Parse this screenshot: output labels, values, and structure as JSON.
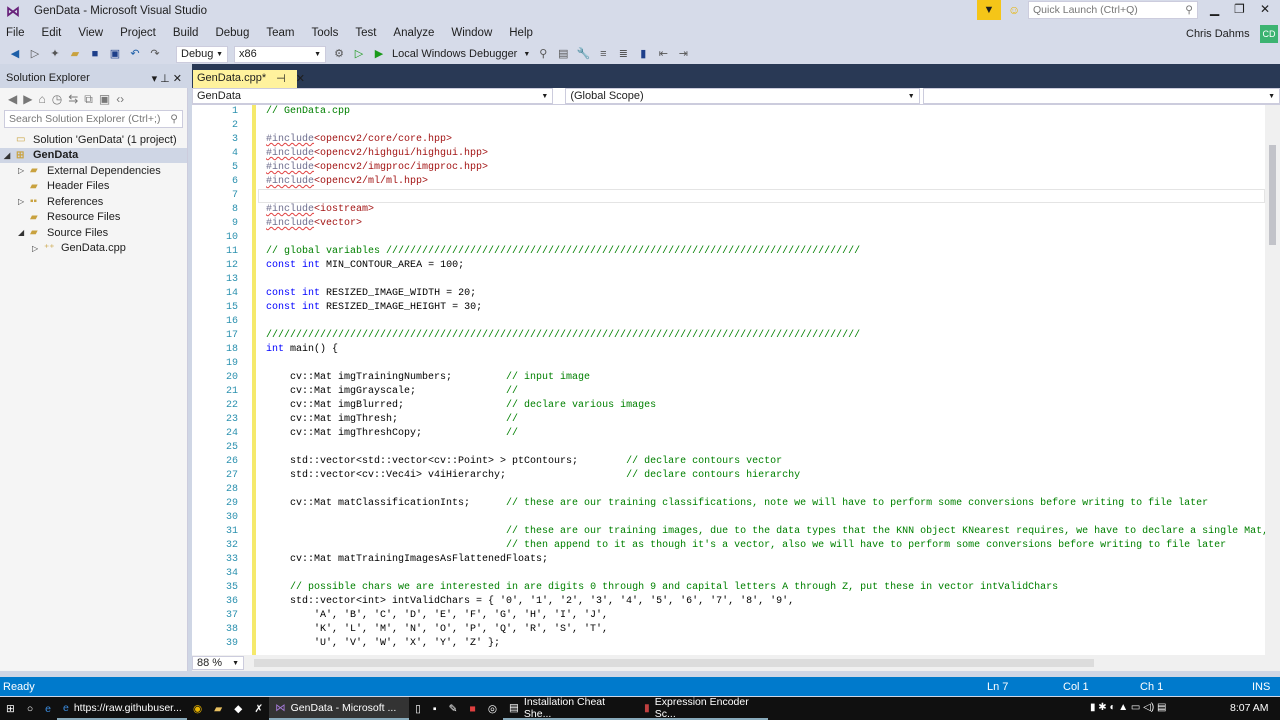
{
  "window": {
    "title": "GenData - Microsoft Visual Studio",
    "quick_launch_placeholder": "Quick Launch (Ctrl+Q)",
    "user": "Chris Dahms",
    "user_initials": "CD"
  },
  "menu": [
    "File",
    "Edit",
    "View",
    "Project",
    "Build",
    "Debug",
    "Team",
    "Tools",
    "Test",
    "Analyze",
    "Window",
    "Help"
  ],
  "toolbar": {
    "config": "Debug",
    "platform": "x86",
    "debugger": "Local Windows Debugger"
  },
  "solution_explorer": {
    "title": "Solution Explorer",
    "search_placeholder": "Search Solution Explorer (Ctrl+;)",
    "items": [
      {
        "label": "Solution 'GenData' (1 project)",
        "level": 0,
        "arrow": "",
        "icon": "solution-icon"
      },
      {
        "label": "GenData",
        "level": 0,
        "arrow": "◢",
        "icon": "project-icon",
        "selected": true
      },
      {
        "label": "External Dependencies",
        "level": 1,
        "arrow": "▷",
        "icon": "folder-icon"
      },
      {
        "label": "Header Files",
        "level": 1,
        "arrow": "",
        "icon": "folder-icon"
      },
      {
        "label": "References",
        "level": 1,
        "arrow": "▷",
        "icon": "references-icon"
      },
      {
        "label": "Resource Files",
        "level": 1,
        "arrow": "",
        "icon": "folder-icon"
      },
      {
        "label": "Source Files",
        "level": 1,
        "arrow": "◢",
        "icon": "folder-icon"
      },
      {
        "label": "GenData.cpp",
        "level": 2,
        "arrow": "▷",
        "icon": "cpp-file-icon"
      }
    ]
  },
  "editor": {
    "tab": "GenData.cpp*",
    "nav_project": "GenData",
    "nav_scope": "(Global Scope)",
    "zoom": "88 %"
  },
  "code": {
    "start_line": 1,
    "lines": [
      "// GenData.cpp",
      "",
      "#include<opencv2/core/core.hpp>",
      "#include<opencv2/highgui/highgui.hpp>",
      "#include<opencv2/imgproc/imgproc.hpp>",
      "#include<opencv2/ml/ml.hpp>",
      "",
      "#include<iostream>",
      "#include<vector>",
      "",
      "// global variables ///////////////////////////////////////////////////////////////////////////////",
      "const int MIN_CONTOUR_AREA = 100;",
      "",
      "const int RESIZED_IMAGE_WIDTH = 20;",
      "const int RESIZED_IMAGE_HEIGHT = 30;",
      "",
      "///////////////////////////////////////////////////////////////////////////////////////////////////",
      "int main() {",
      "",
      "    cv::Mat imgTrainingNumbers;         // input image",
      "    cv::Mat imgGrayscale;               //",
      "    cv::Mat imgBlurred;                 // declare various images",
      "    cv::Mat imgThresh;                  //",
      "    cv::Mat imgThreshCopy;              //",
      "",
      "    std::vector<std::vector<cv::Point> > ptContours;        // declare contours vector",
      "    std::vector<cv::Vec4i> v4iHierarchy;                    // declare contours hierarchy",
      "",
      "    cv::Mat matClassificationInts;      // these are our training classifications, note we will have to perform some conversions before writing to file later",
      "",
      "                                        // these are our training images, due to the data types that the KNN object KNearest requires, we have to declare a single Mat,",
      "                                        // then append to it as though it's a vector, also we will have to perform some conversions before writing to file later",
      "    cv::Mat matTrainingImagesAsFlattenedFloats;",
      "",
      "    // possible chars we are interested in are digits 0 through 9 and capital letters A through Z, put these in vector intValidChars",
      "    std::vector<int> intValidChars = { '0', '1', '2', '3', '4', '5', '6', '7', '8', '9',",
      "        'A', 'B', 'C', 'D', 'E', 'F', 'G', 'H', 'I', 'J',",
      "        'K', 'L', 'M', 'N', 'O', 'P', 'Q', 'R', 'S', 'T',",
      "        'U', 'V', 'W', 'X', 'Y', 'Z' };"
    ],
    "cursor_line": 7
  },
  "status": {
    "text": "Ready",
    "ln": "Ln 7",
    "col": "Col 1",
    "ch": "Ch 1",
    "mode": "INS"
  },
  "taskbar": {
    "items": [
      "https://raw.githubuser...",
      "GenData - Microsoft ...",
      "Installation Cheat She...",
      "Expression Encoder Sc..."
    ],
    "clock": "8:07 AM"
  },
  "colors": {
    "accent": "#007acc",
    "tab": "#fff29d",
    "band": "#293955"
  }
}
